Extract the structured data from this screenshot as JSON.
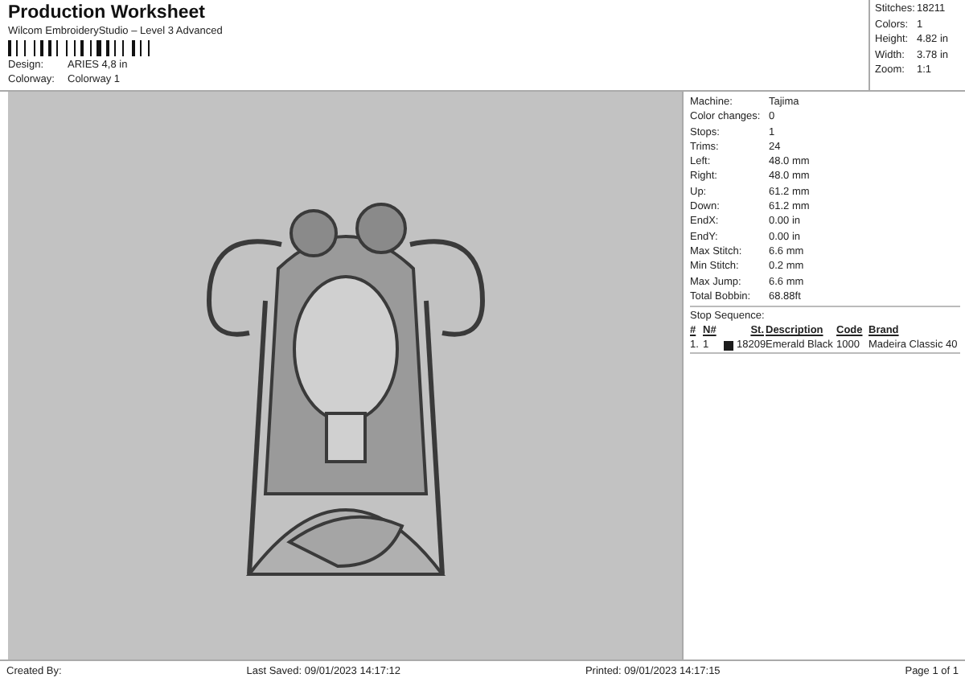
{
  "header": {
    "title": "Production Worksheet",
    "subtitle": "Wilcom EmbroideryStudio – Level 3 Advanced",
    "fields": [
      {
        "label": "Design:",
        "value": "ARIES 4,8 in"
      },
      {
        "label": "Colorway:",
        "value": "Colorway 1"
      }
    ]
  },
  "summary": [
    {
      "label": "Stitches:",
      "value": "18211"
    },
    {
      "label": "Colors:",
      "value": "1"
    },
    {
      "label": "Height:",
      "value": "4.82 in"
    },
    {
      "label": "Width:",
      "value": "3.78 in"
    },
    {
      "label": "Zoom:",
      "value": "1:1"
    }
  ],
  "details": [
    {
      "label": "Machine:",
      "value": "Tajima"
    },
    {
      "label": "Color changes:",
      "value": "0"
    },
    {
      "label": "Stops:",
      "value": "1"
    },
    {
      "label": "Trims:",
      "value": "24"
    },
    {
      "label": "Left:",
      "value": "48.0 mm"
    },
    {
      "label": "Right:",
      "value": "48.0 mm"
    },
    {
      "label": "Up:",
      "value": "61.2 mm"
    },
    {
      "label": "Down:",
      "value": "61.2 mm"
    },
    {
      "label": "EndX:",
      "value": "0.00 in"
    },
    {
      "label": "EndY:",
      "value": "0.00 in"
    },
    {
      "label": "Max Stitch:",
      "value": "6.6 mm"
    },
    {
      "label": "Min Stitch:",
      "value": "0.2 mm"
    },
    {
      "label": "Max Jump:",
      "value": "6.6 mm"
    },
    {
      "label": "Total Bobbin:",
      "value": "68.88ft"
    }
  ],
  "stop_sequence": {
    "title": "Stop Sequence:",
    "columns": [
      "#",
      "N#",
      "St.",
      "Description",
      "Code",
      "Brand"
    ],
    "rows": [
      {
        "index": "1.",
        "needle": "1",
        "color": "#1c1c1c",
        "stitches": "18209",
        "description": "Emerald Black",
        "code": "1000",
        "brand": "Madeira Classic 40"
      }
    ]
  },
  "footer": {
    "created_by": "Created By:",
    "last_saved": "Last Saved: 09/01/2023 14:17:12",
    "printed": "Printed: 09/01/2023 14:17:15",
    "page": "Page 1 of 1"
  }
}
